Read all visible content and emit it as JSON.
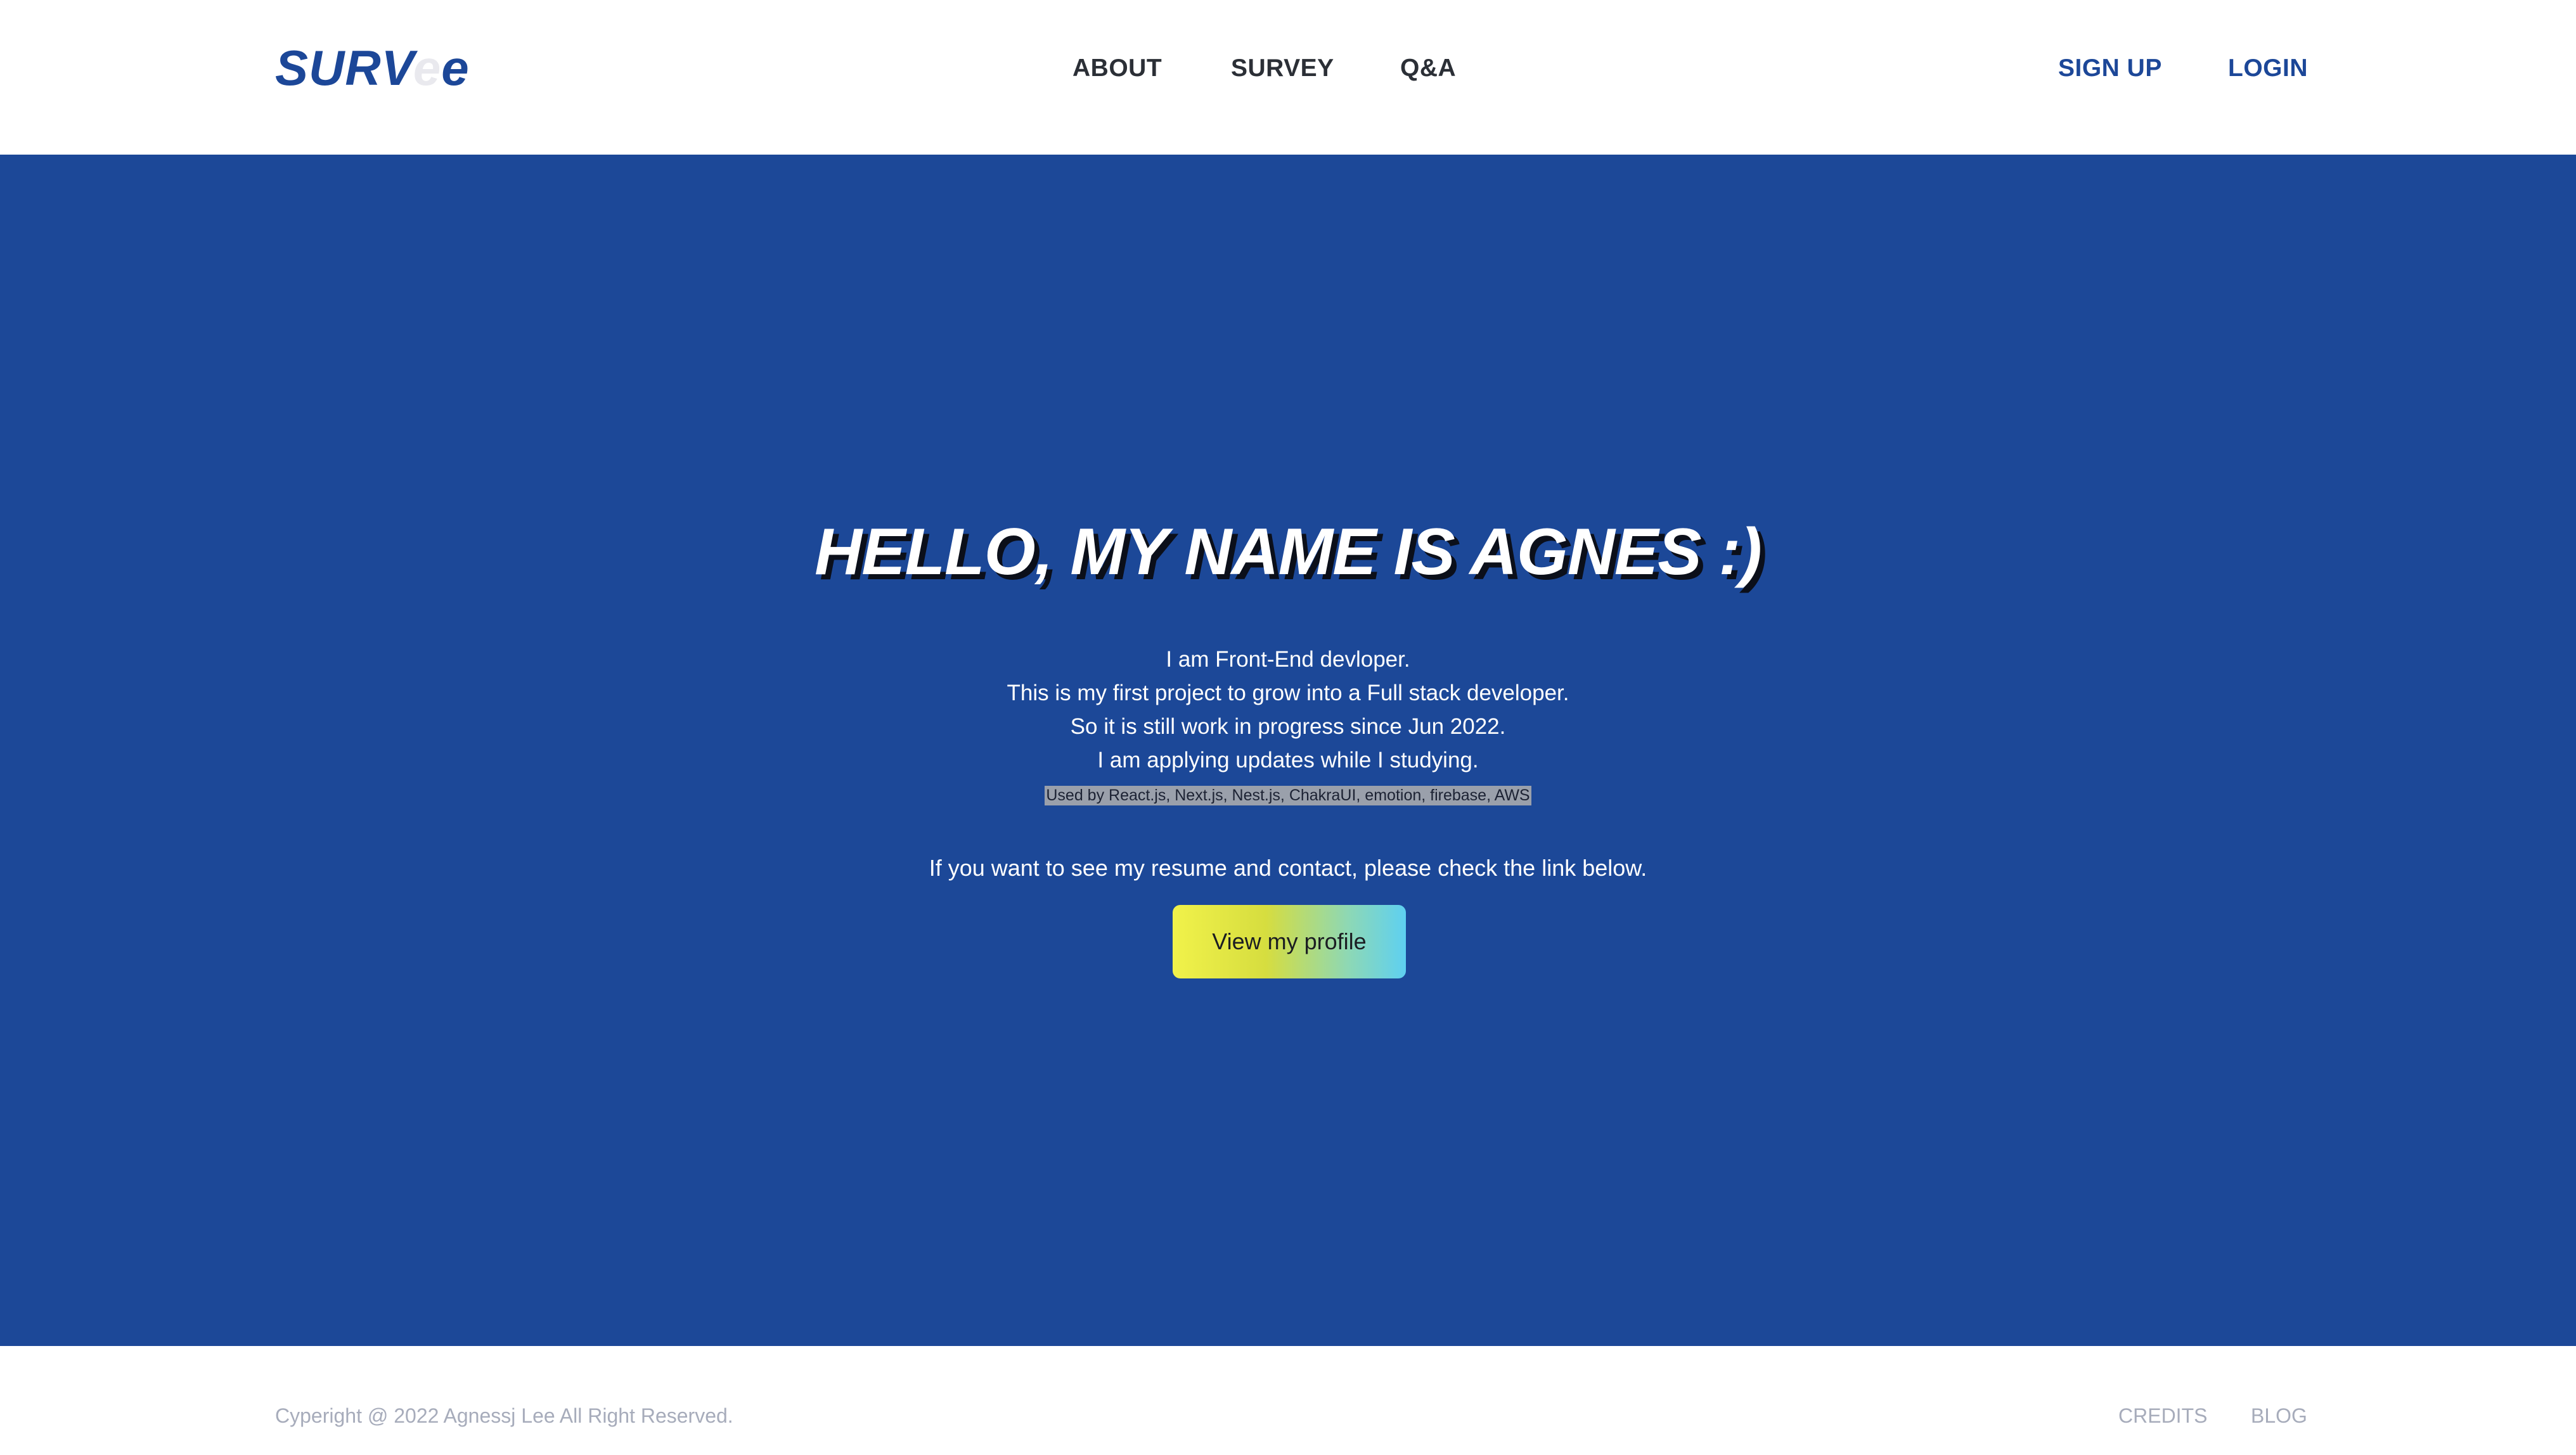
{
  "header": {
    "logo_part1": "SURV",
    "logo_part2": "e",
    "logo_part3": "e",
    "nav": {
      "about": "ABOUT",
      "survey": "SURVEY",
      "qa": "Q&A"
    },
    "auth": {
      "signup": "SIGN UP",
      "login": "LOGIN"
    }
  },
  "hero": {
    "title": "HELLO, MY NAME IS AGNES :)",
    "intro": [
      "I am Front-End devloper.",
      "This is my first project to grow into a Full stack developer.",
      "So it is still work in progress since Jun 2022.",
      "I am applying updates while I studying."
    ],
    "tech_stack": "Used by React.js, Next.js, Nest.js, ChakraUI, emotion, firebase, AWS",
    "resume_text": "If you want to see my resume and contact, please check the link below.",
    "profile_button": "View my profile"
  },
  "footer": {
    "copyright": "Cyperight @ 2022 Agnessj Lee All Right Reserved.",
    "credits": "CREDITS",
    "blog": "BLOG"
  },
  "colors": {
    "brand_blue": "#1c4898",
    "header_bg": "#ffffff",
    "nav_text": "#2b2f36",
    "footer_text": "#a7acbb",
    "button_gradient_start": "#f1f24a",
    "button_gradient_end": "#5ed0f1"
  }
}
